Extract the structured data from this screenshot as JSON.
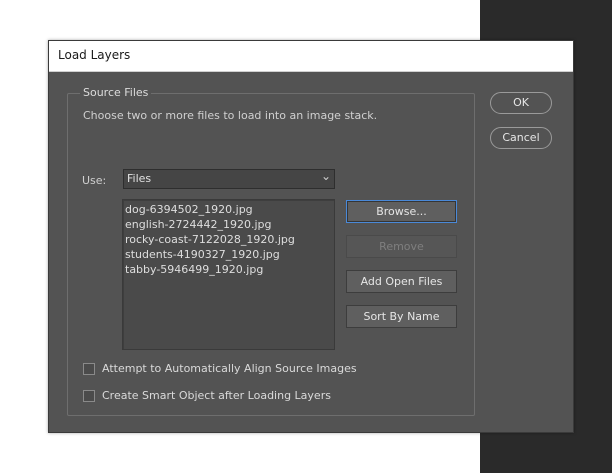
{
  "dialog": {
    "title": "Load Layers",
    "source_files": {
      "legend": "Source Files",
      "description": "Choose two or more files to load into an image stack.",
      "use_label": "Use:",
      "use_value": "Files",
      "files": [
        "dog-6394502_1920.jpg",
        "english-2724442_1920.jpg",
        "rocky-coast-7122028_1920.jpg",
        "students-4190327_1920.jpg",
        "tabby-5946499_1920.jpg"
      ],
      "buttons": {
        "browse": "Browse...",
        "remove": "Remove",
        "add_open_files": "Add Open Files",
        "sort_by_name": "Sort By Name"
      }
    },
    "options": {
      "auto_align": {
        "label": "Attempt to Automatically Align Source Images",
        "checked": false
      },
      "smart_object": {
        "label": "Create Smart Object after Loading Layers",
        "checked": false
      }
    },
    "ok_label": "OK",
    "cancel_label": "Cancel"
  },
  "icons": {
    "dropdown": "chevron-down-icon"
  }
}
